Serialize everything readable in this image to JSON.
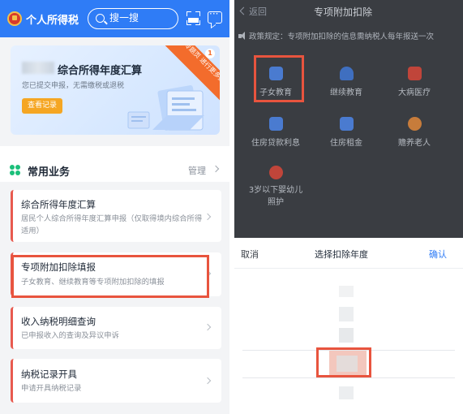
{
  "left": {
    "app_title": "个人所得税",
    "search_placeholder": "搜一搜",
    "banner": {
      "title": "综合所得年度汇算",
      "subtitle": "您已提交申报，无需缴税或退税",
      "button": "查看记录",
      "ribbon": "进入专题页 进行更多操作",
      "ribbon_badge": "1"
    },
    "common": {
      "title": "常用业务",
      "manage": "管理"
    },
    "services": [
      {
        "title": "综合所得年度汇算",
        "desc": "居民个人综合所得年度汇算申报（仅取得境内综合所得适用）"
      },
      {
        "title": "专项附加扣除填报",
        "desc": "子女教育、继续教育等专项附加扣除的填报"
      },
      {
        "title": "收入纳税明细查询",
        "desc": "已申报收入的查询及异议申诉"
      },
      {
        "title": "纳税记录开具",
        "desc": "申请开具纳税记录"
      }
    ]
  },
  "right": {
    "back": "返回",
    "title": "专项附加扣除",
    "notice": "政策规定：专项附加扣除的信息需纳税人每年报送一次",
    "categories": [
      {
        "label": "子女教育",
        "icon": "child-education-icon",
        "color": "#4a7bd0"
      },
      {
        "label": "继续教育",
        "icon": "graduation-cap-icon",
        "color": "#3f6fc0"
      },
      {
        "label": "大病医疗",
        "icon": "medical-kit-icon",
        "color": "#c0453a"
      },
      {
        "label": "住房贷款利息",
        "icon": "house-loan-icon",
        "color": "#4a7bd0"
      },
      {
        "label": "住房租金",
        "icon": "house-rent-icon",
        "color": "#4a7bd0"
      },
      {
        "label": "赡养老人",
        "icon": "elderly-icon",
        "color": "#c77c3b"
      },
      {
        "label": "3岁以下婴幼儿照护",
        "icon": "infant-care-icon",
        "color": "#c0453a"
      }
    ],
    "sheet": {
      "cancel": "取消",
      "title": "选择扣除年度",
      "confirm": "确认"
    }
  },
  "colors": {
    "brand_blue": "#2f7cf6",
    "highlight_red": "#e8543e",
    "accent_green": "#1bbf7a"
  }
}
